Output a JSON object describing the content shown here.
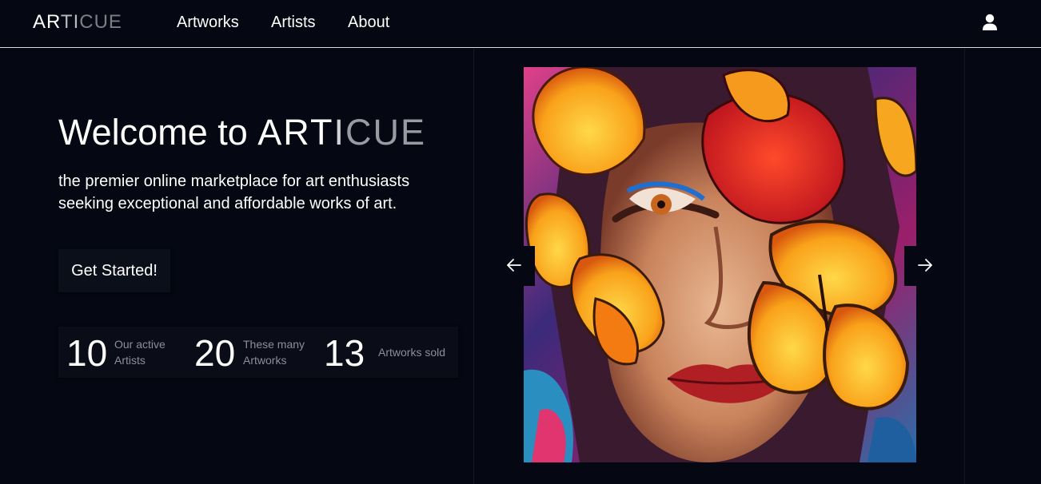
{
  "navbar": {
    "brand": {
      "part_a": "AR",
      "part_b": "TI",
      "part_c": "CUE"
    },
    "links": [
      "Artworks",
      "Artists",
      "About"
    ],
    "user_icon": "user-icon"
  },
  "hero": {
    "title_prefix": "Welcome to",
    "brand_word": {
      "part_a": "ART",
      "part_b": "I",
      "part_c": "CUE"
    },
    "subtitle": "the premier online marketplace for art enthusiasts seeking exceptional and affordable works of art.",
    "cta_label": "Get Started!"
  },
  "stats": [
    {
      "value": "10",
      "label_line1": "Our active",
      "label_line2": "Artists"
    },
    {
      "value": "20",
      "label_line1": "These many",
      "label_line2": "Artworks"
    },
    {
      "value": "13",
      "label_line1": "Artworks sold",
      "label_line2": ""
    }
  ],
  "carousel": {
    "prev_icon": "arrow-left-icon",
    "next_icon": "arrow-right-icon",
    "artwork": "woman-with-butterflies-painting"
  },
  "colors": {
    "background": "#050812",
    "text": "#ffffff",
    "muted_text": "#8b8e9b",
    "nav_border": "#d9d9d9"
  }
}
